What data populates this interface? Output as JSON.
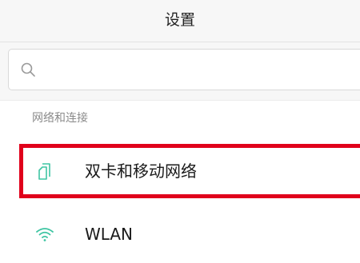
{
  "header": {
    "title": "设置"
  },
  "search": {
    "placeholder": "",
    "icon": "search-icon"
  },
  "section": {
    "label": "网络和连接"
  },
  "items": [
    {
      "label": "双卡和移动网络",
      "icon": "sim-card-icon",
      "icon_color": "#3fc5a3"
    },
    {
      "label": "WLAN",
      "icon": "wifi-icon",
      "icon_color": "#3fc5a3"
    }
  ],
  "colors": {
    "accent": "#3fc5a3",
    "highlight": "#e0001b",
    "header_bg": "#f7f7f7"
  }
}
